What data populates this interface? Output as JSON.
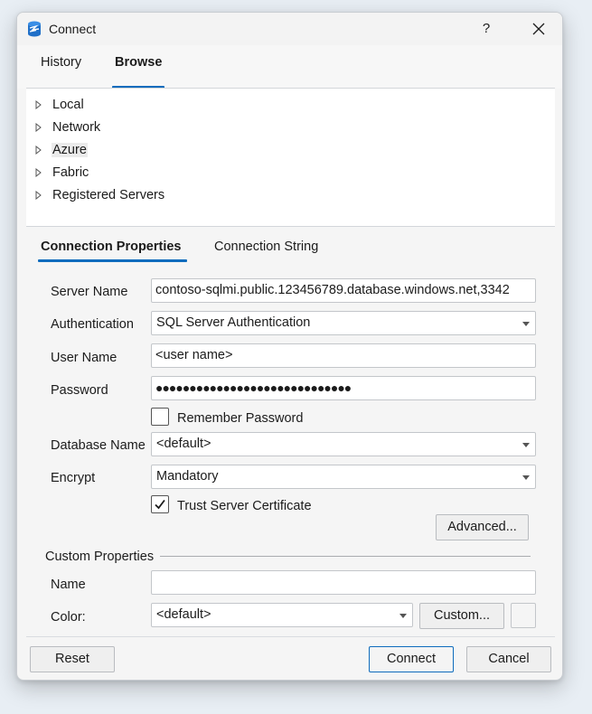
{
  "window": {
    "title": "Connect",
    "help_label": "?",
    "accent_color": "#0f6cbd"
  },
  "top_tabs": [
    {
      "label": "History",
      "selected": false
    },
    {
      "label": "Browse",
      "selected": true
    }
  ],
  "tree": {
    "items": [
      {
        "label": "Local",
        "selected": false
      },
      {
        "label": "Network",
        "selected": false
      },
      {
        "label": "Azure",
        "selected": true
      },
      {
        "label": "Fabric",
        "selected": false
      },
      {
        "label": "Registered Servers",
        "selected": false
      }
    ]
  },
  "props_tabs": [
    {
      "label": "Connection Properties",
      "selected": true
    },
    {
      "label": "Connection String",
      "selected": false
    }
  ],
  "form": {
    "server_name": {
      "label": "Server Name",
      "value": "contoso-sqlmi.public.123456789.database.windows.net,3342"
    },
    "authentication": {
      "label": "Authentication",
      "value": "SQL Server Authentication"
    },
    "user_name": {
      "label": "User Name",
      "value": "<user name>"
    },
    "password": {
      "label": "Password",
      "value": "●●●●●●●●●●●●●●●●●●●●●●●●●●●●●"
    },
    "remember_password": {
      "label": "Remember Password",
      "checked": false
    },
    "database_name": {
      "label": "Database Name",
      "value": "<default>"
    },
    "encrypt": {
      "label": "Encrypt",
      "value": "Mandatory"
    },
    "trust_server_certificate": {
      "label": "Trust Server Certificate",
      "checked": true
    },
    "advanced_label": "Advanced..."
  },
  "custom_properties": {
    "group_label": "Custom Properties",
    "name": {
      "label": "Name",
      "value": ""
    },
    "color": {
      "label": "Color:",
      "value": "<default>"
    },
    "custom_button_label": "Custom..."
  },
  "footer": {
    "reset_label": "Reset",
    "connect_label": "Connect",
    "cancel_label": "Cancel"
  },
  "icons": {
    "app": "database-icon",
    "close": "close-icon",
    "tree_arrow": "triangle-right-icon",
    "dropdown": "chevron-down-icon",
    "check": "check-icon"
  }
}
